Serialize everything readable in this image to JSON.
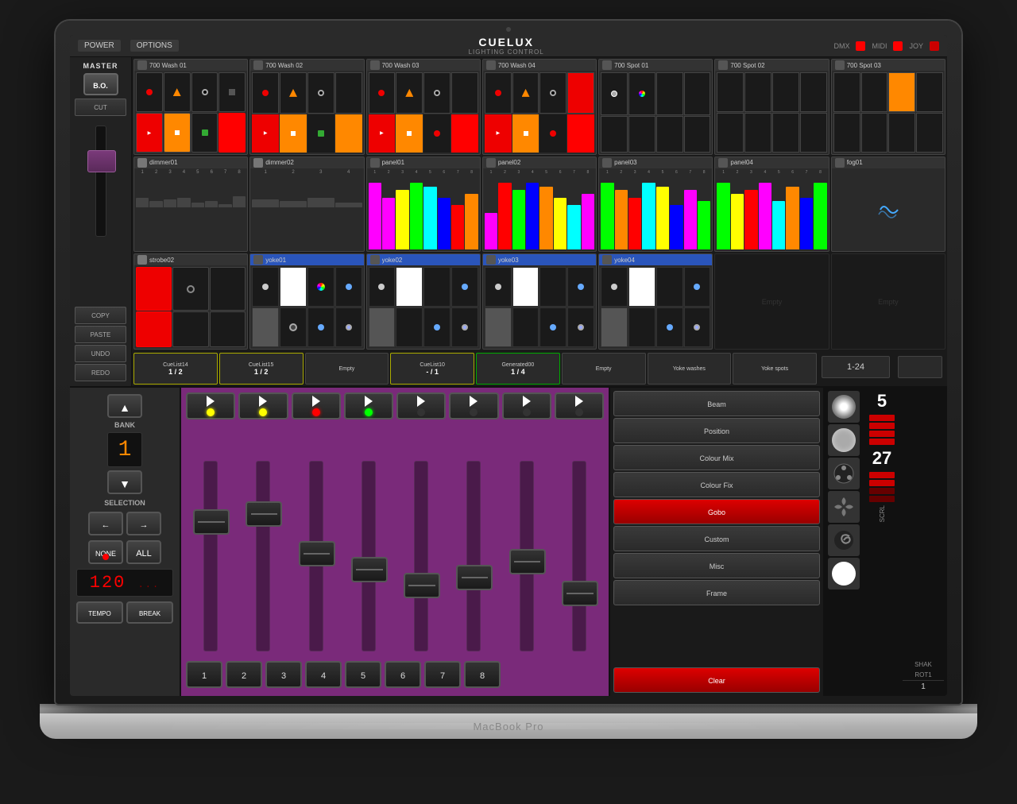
{
  "app": {
    "title": "CUELUX",
    "subtitle": "LIGHTING CONTROL",
    "topbar": {
      "power": "POWER",
      "options": "OPTIONS",
      "dmx": "DMX",
      "midi": "MIDI",
      "joy": "JOY"
    }
  },
  "master": {
    "label": "MASTER",
    "bo_label": "B.O.",
    "cut": "CUT",
    "copy": "COPY",
    "paste": "PASTE",
    "undo": "UNDO",
    "redo": "REDO"
  },
  "fixtures": {
    "row1": [
      {
        "name": "700 Wash 01"
      },
      {
        "name": "700 Wash 02"
      },
      {
        "name": "700 Wash 03"
      },
      {
        "name": "700 Wash 04"
      },
      {
        "name": "700 Spot 01"
      },
      {
        "name": "700 Spot 02"
      },
      {
        "name": "700 Spot 03"
      }
    ],
    "row2": [
      {
        "name": "dimmer01"
      },
      {
        "name": "dimmer02"
      },
      {
        "name": "panel01"
      },
      {
        "name": "panel02"
      },
      {
        "name": "panel03"
      },
      {
        "name": "panel04"
      },
      {
        "name": "fog01"
      }
    ],
    "row3": [
      {
        "name": "strobe02"
      },
      {
        "name": "yoke01",
        "highlighted": true
      },
      {
        "name": "yoke02",
        "highlighted": true
      },
      {
        "name": "yoke03",
        "highlighted": true
      },
      {
        "name": "yoke04",
        "highlighted": true
      },
      {
        "name": "Empty",
        "empty": true
      },
      {
        "name": "Empty",
        "empty": true
      }
    ]
  },
  "cuelist": {
    "cells": [
      {
        "name": "CueList14",
        "progress": "1 / 2",
        "border": "yellow"
      },
      {
        "name": "CueList15",
        "progress": "1 / 2",
        "border": "yellow"
      },
      {
        "name": "Empty",
        "progress": "",
        "border": "none"
      },
      {
        "name": "CueList10",
        "progress": "-/ 1",
        "border": "yellow"
      },
      {
        "name": "Generated00",
        "progress": "1 / 4",
        "border": "green"
      },
      {
        "name": "Empty",
        "progress": "",
        "border": "none"
      },
      {
        "name": "Yoke washes",
        "progress": "",
        "border": "none"
      },
      {
        "name": "Yoke spots",
        "progress": "",
        "border": "none"
      }
    ]
  },
  "controller": {
    "bank_label": "BANK",
    "bank_value": "1",
    "selection_label": "SELECTION",
    "none_label": "NONE",
    "all_label": "ALL",
    "bpm": "120",
    "tempo": "TEMPO",
    "break_label": "BREAK",
    "range": "1-24",
    "faders": [
      1,
      2,
      3,
      4,
      5,
      6,
      7,
      8
    ],
    "fader_leds": [
      "yellow",
      "yellow",
      "red",
      "green",
      "off",
      "off",
      "off",
      "off"
    ]
  },
  "attributes": {
    "beam": "Beam",
    "position": "Position",
    "colour_mix": "Colour Mix",
    "colour_fix": "Colour Fix",
    "gobo": "Gobo",
    "custom": "Custom",
    "misc": "Misc",
    "frame": "Frame",
    "clear": "Clear",
    "shak": "SHAK",
    "rot1": "ROT1",
    "number1": "5",
    "number2": "27",
    "number3": "1",
    "scrl": "SCRL"
  },
  "macbook_label": "MacBook Pro"
}
